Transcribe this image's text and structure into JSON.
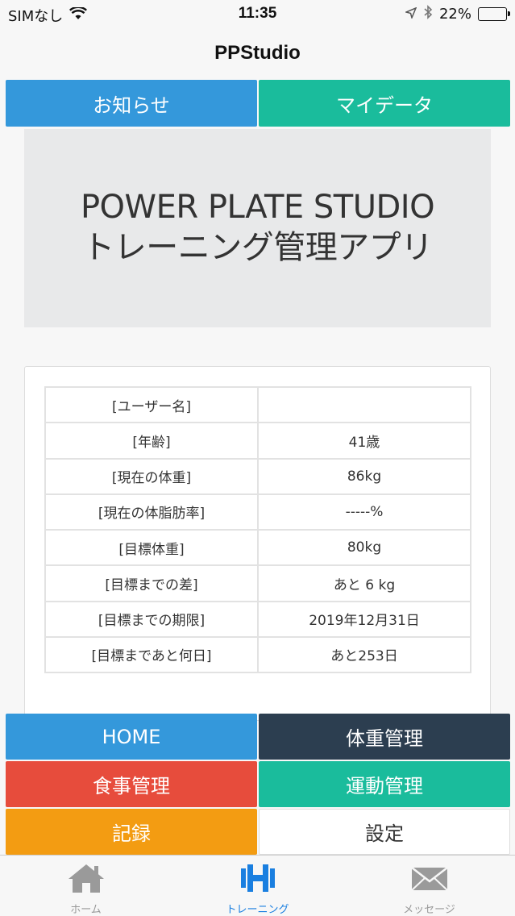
{
  "status_bar": {
    "carrier": "SIMなし",
    "time": "11:35",
    "battery": "22%",
    "battery_level_percent": 22
  },
  "nav": {
    "title": "PPStudio"
  },
  "top_tabs": [
    {
      "label": "お知らせ",
      "color": "#3498db"
    },
    {
      "label": "マイデータ",
      "color": "#1abc9c"
    }
  ],
  "hero": {
    "line1": "POWER PLATE STUDIO",
    "line2": "トレーニング管理アプリ"
  },
  "info_table": {
    "rows": [
      {
        "label": "[ユーザー名]",
        "value": ""
      },
      {
        "label": "[年齢]",
        "value": "41歳"
      },
      {
        "label": "[現在の体重]",
        "value": "86kg"
      },
      {
        "label": "[現在の体脂肪率]",
        "value": "-----%"
      },
      {
        "label": "[目標体重]",
        "value": "80kg"
      },
      {
        "label": "[目標までの差]",
        "value": "あと 6 kg"
      },
      {
        "label": "[目標までの期限]",
        "value": "2019年12月31日"
      },
      {
        "label": "[目標まであと何日]",
        "value": "あと253日"
      }
    ]
  },
  "menu": [
    {
      "label": "HOME",
      "color": "#3498db"
    },
    {
      "label": "体重管理",
      "color": "#2c3e50"
    },
    {
      "label": "食事管理",
      "color": "#e74c3c"
    },
    {
      "label": "運動管理",
      "color": "#1abc9c"
    },
    {
      "label": "記録",
      "color": "#f39c12"
    },
    {
      "label": "設定",
      "color": "#ffffff"
    }
  ],
  "tab_bar": {
    "items": [
      {
        "label": "ホーム",
        "icon": "home-icon",
        "active": false
      },
      {
        "label": "トレーニング",
        "icon": "training-icon",
        "active": true
      },
      {
        "label": "メッセージ",
        "icon": "mail-icon",
        "active": false
      }
    ]
  }
}
